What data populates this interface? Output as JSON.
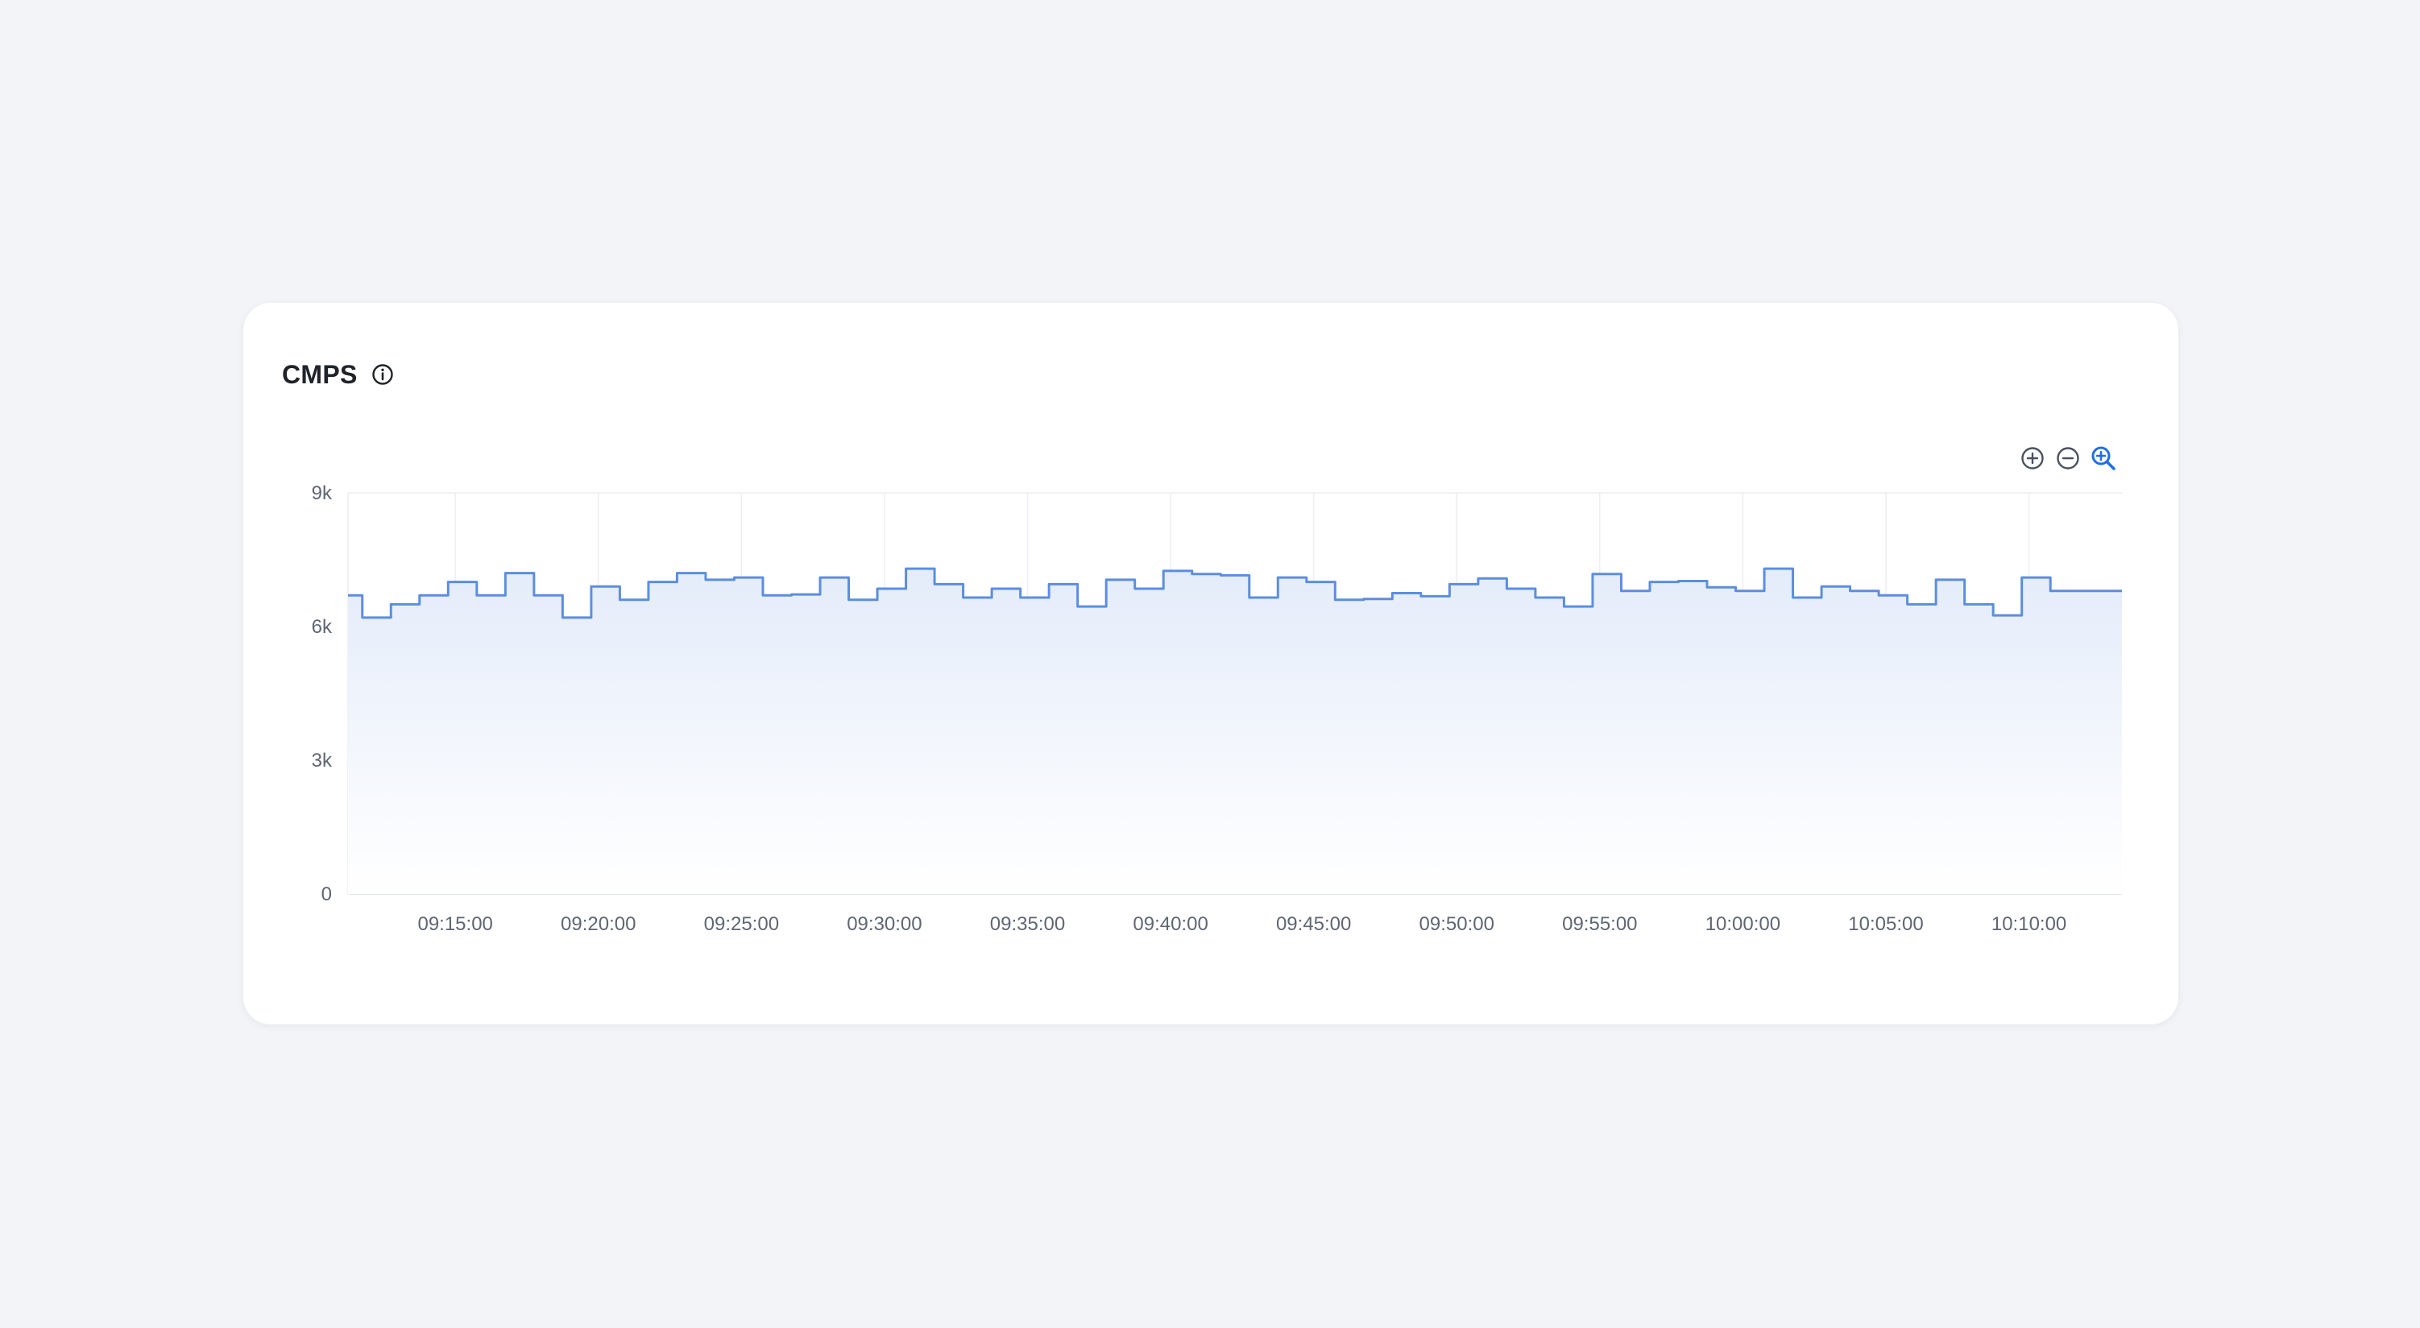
{
  "card": {
    "title": "CMPS"
  },
  "icons": {
    "info": "info-circle-icon",
    "zoom_in": "zoom-in-icon",
    "zoom_out": "zoom-out-icon",
    "zoom_reset": "zoom-reset-icon"
  },
  "colors": {
    "line": "#5b8ee0",
    "area_top": "#e6eefb",
    "grid": "#eceef1",
    "accent": "#1f6fe5",
    "tool": "#4a5160"
  },
  "chart_data": {
    "type": "area",
    "title": "CMPS",
    "xlabel": "",
    "ylabel": "",
    "step": true,
    "ylim": [
      0,
      9000
    ],
    "y_ticks": [
      0,
      3000,
      6000,
      9000
    ],
    "y_tick_labels": [
      "0",
      "3k",
      "6k",
      "9k"
    ],
    "x_range": [
      "09:11:15",
      "10:13:15"
    ],
    "x_ticks": [
      "09:15:00",
      "09:20:00",
      "09:25:00",
      "09:30:00",
      "09:35:00",
      "09:40:00",
      "09:45:00",
      "09:50:00",
      "09:55:00",
      "10:00:00",
      "10:05:00",
      "10:10:00"
    ],
    "grid": true,
    "series": [
      {
        "x": [
          "09:11:15",
          "09:11:45",
          "09:12:45",
          "09:13:45",
          "09:14:45",
          "09:15:45",
          "09:16:45",
          "09:17:45",
          "09:18:45",
          "09:19:45",
          "09:20:45",
          "09:21:45",
          "09:22:45",
          "09:23:45",
          "09:24:45",
          "09:25:45",
          "09:26:45",
          "09:27:45",
          "09:28:45",
          "09:29:45",
          "09:30:45",
          "09:31:45",
          "09:32:45",
          "09:33:45",
          "09:34:45",
          "09:35:45",
          "09:36:45",
          "09:37:45",
          "09:38:45",
          "09:39:45",
          "09:40:45",
          "09:41:45",
          "09:42:45",
          "09:43:45",
          "09:44:45",
          "09:45:45",
          "09:46:45",
          "09:47:45",
          "09:48:45",
          "09:49:45",
          "09:50:45",
          "09:51:45",
          "09:52:45",
          "09:53:45",
          "09:54:45",
          "09:55:45",
          "09:56:45",
          "09:57:45",
          "09:58:45",
          "09:59:45",
          "10:00:45",
          "10:01:45",
          "10:02:45",
          "10:03:45",
          "10:04:45",
          "10:05:45",
          "10:06:45",
          "10:07:45",
          "10:08:45",
          "10:09:45",
          "10:10:45",
          "10:11:45",
          "10:12:45"
        ],
        "values": [
          6700,
          6200,
          6500,
          6700,
          7000,
          6700,
          7200,
          6700,
          6200,
          6900,
          6600,
          7000,
          7200,
          7050,
          7100,
          6700,
          6720,
          7100,
          6600,
          6850,
          7300,
          6950,
          6650,
          6850,
          6650,
          6950,
          6450,
          7050,
          6850,
          7250,
          7180,
          7150,
          6650,
          7100,
          7000,
          6600,
          6620,
          6750,
          6680,
          6950,
          7080,
          6850,
          6650,
          6450,
          7180,
          6800,
          7000,
          7020,
          6880,
          6800,
          7300,
          6650,
          6900,
          6800,
          6700,
          6500,
          7050,
          6500,
          6250,
          7100,
          6800,
          6800,
          6800
        ]
      }
    ]
  }
}
